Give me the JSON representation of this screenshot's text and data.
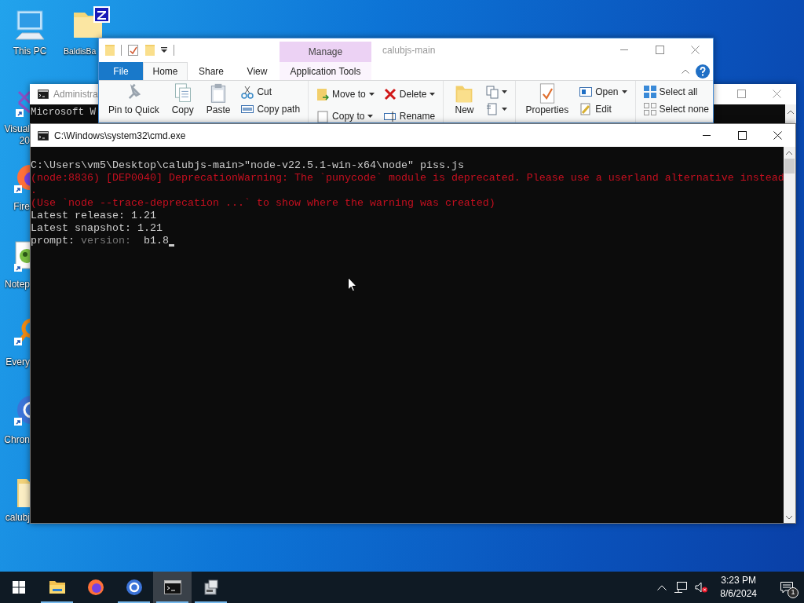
{
  "desktop_icons": [
    {
      "label": "This PC"
    },
    {
      "label": "BaldisBa"
    },
    {
      "label": "Visual 20"
    },
    {
      "label": "Fire"
    },
    {
      "label": "Notep"
    },
    {
      "label": "Every"
    },
    {
      "label": "Chron"
    },
    {
      "label": "calubj"
    }
  ],
  "explorer": {
    "title": "calubjs-main",
    "context_header": "Manage",
    "tabs": [
      {
        "label": "File",
        "kind": "file",
        "selected": false
      },
      {
        "label": "Home",
        "kind": "tab",
        "selected": true
      },
      {
        "label": "Share",
        "kind": "tab",
        "selected": false
      },
      {
        "label": "View",
        "kind": "tab",
        "selected": false
      },
      {
        "label": "Application Tools",
        "kind": "context",
        "selected": false
      }
    ],
    "ribbon": [
      {
        "columns": [
          [
            {
              "label": "Pin to Quick",
              "kind": "large"
            }
          ],
          [
            {
              "label": "Copy",
              "kind": "large"
            }
          ],
          [
            {
              "label": "Paste",
              "kind": "large"
            }
          ],
          [
            {
              "label": "Cut",
              "kind": "small"
            },
            {
              "label": "Copy path",
              "kind": "small"
            }
          ]
        ]
      },
      {
        "columns": [
          [
            {
              "label": "Move to",
              "kind": "medium",
              "dropdown": true
            },
            {
              "label": "Copy to",
              "kind": "medium",
              "dropdown": true
            }
          ],
          [
            {
              "label": "Delete",
              "kind": "medium",
              "dropdown": true
            },
            {
              "label": "Rename",
              "kind": "medium"
            }
          ]
        ]
      },
      {
        "columns": [
          [
            {
              "label": "New",
              "kind": "large"
            }
          ],
          [
            {
              "kind": "small",
              "dropdown": true
            },
            {
              "kind": "small",
              "dropdown": true
            }
          ]
        ]
      },
      {
        "columns": [
          [
            {
              "label": "Properties",
              "kind": "large"
            }
          ],
          [
            {
              "label": "Open",
              "kind": "small",
              "dropdown": true
            },
            {
              "label": "Edit",
              "kind": "small"
            }
          ]
        ]
      },
      {
        "columns": [
          [
            {
              "label": "Select all",
              "kind": "small"
            },
            {
              "label": "Select none",
              "kind": "small"
            }
          ]
        ]
      }
    ]
  },
  "admin_window": {
    "title": "Administra",
    "lines": [
      "Microsoft W"
    ]
  },
  "cmd_window": {
    "title": "C:\\Windows\\system32\\cmd.exe",
    "lines": [
      {
        "kind": "out",
        "text": "C:\\Users\\vm5\\Desktop\\calubjs-main>\"node-v22.5.1-win-x64\\node\" piss.js"
      },
      {
        "kind": "error",
        "text": "(node:8836) [DEP0040] DeprecationWarning: The `punycode` module is deprecated. Please use a userland alternative instead"
      },
      {
        "kind": "error",
        "text": "."
      },
      {
        "kind": "error",
        "text": "(Use `node --trace-deprecation ...` to show where the warning was created)"
      },
      {
        "kind": "out",
        "text": "Latest release: 1.21"
      },
      {
        "kind": "out",
        "text": "Latest snapshot: 1.21"
      }
    ],
    "prompt": {
      "label": "prompt:",
      "hint": "version:",
      "value": "b1.8"
    }
  },
  "taskbar": {
    "apps": [
      {
        "running": true,
        "active": false
      },
      {
        "running": false,
        "active": false
      },
      {
        "running": true,
        "active": false
      },
      {
        "running": true,
        "active": true
      },
      {
        "running": true,
        "active": false
      }
    ],
    "clock": {
      "time": "3:23 PM",
      "date": "8/6/2024"
    },
    "notifications": {
      "count": "1"
    }
  }
}
